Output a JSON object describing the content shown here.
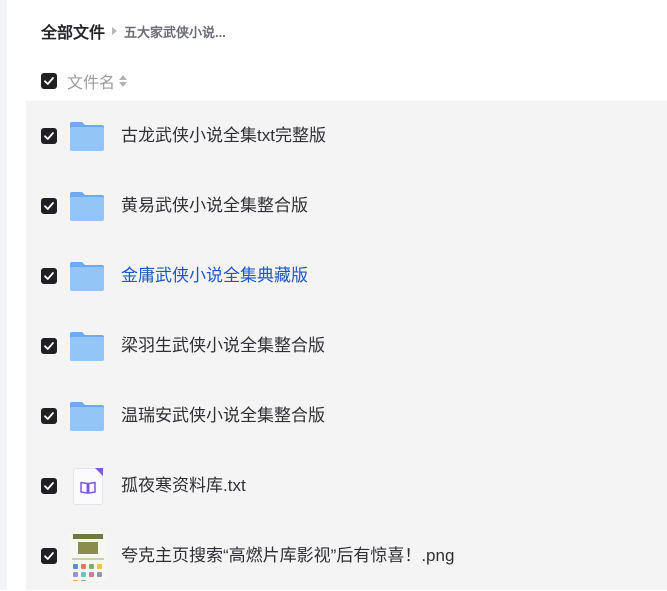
{
  "breadcrumb": {
    "root": "全部文件",
    "current": "五大家武侠小说..."
  },
  "header": {
    "column_name": "文件名"
  },
  "files": [
    {
      "name": "古龙武侠小说全集txt完整版",
      "type": "folder",
      "checked": true,
      "icon": "folder-icon"
    },
    {
      "name": "黄易武侠小说全集整合版",
      "type": "folder",
      "checked": true,
      "icon": "folder-icon"
    },
    {
      "name": "金庸武侠小说全集典藏版",
      "type": "folder",
      "checked": true,
      "hovered": true,
      "icon": "folder-icon"
    },
    {
      "name": "梁羽生武侠小说全集整合版",
      "type": "folder",
      "checked": true,
      "icon": "folder-icon"
    },
    {
      "name": "温瑞安武侠小说全集整合版",
      "type": "folder",
      "checked": true,
      "icon": "folder-icon"
    },
    {
      "name": "孤夜寒资料库.txt",
      "type": "txt",
      "checked": true,
      "icon": "txt-file-icon"
    },
    {
      "name": "夸克主页搜索“高燃片库影视”后有惊喜！.png",
      "type": "image",
      "checked": true,
      "icon": "image-thumbnail"
    }
  ],
  "colors": {
    "checkbox": "#1f1f24",
    "folder": "#8ec1f5",
    "link": "#1c58c7",
    "list_background": "#f4f4f5"
  }
}
